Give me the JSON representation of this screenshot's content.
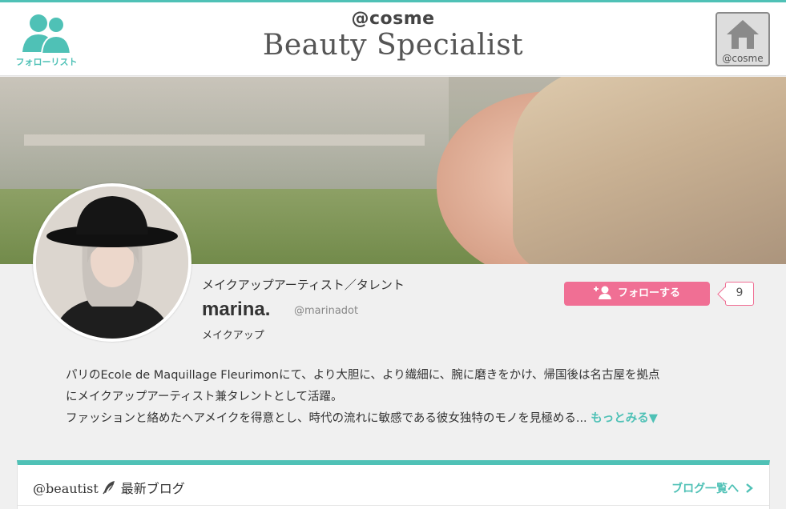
{
  "header": {
    "follow_list_label": "フォローリスト",
    "brand_top": "@cosme",
    "brand_main": "Beauty Specialist",
    "home_label": "@cosme"
  },
  "profile": {
    "role": "メイクアップアーティスト／タレント",
    "name": "marina.",
    "handle": "@marinadot",
    "genre": "メイクアップ",
    "follow_button": "フォローする",
    "follower_count": "9",
    "bio_lines": [
      "パリのEcole de Maquillage Fleurimonにて、より大胆に、より繊細に、腕に磨きをかけ、帰国後は名古屋を拠点",
      "にメイクアップアーティスト兼タレントとして活躍。",
      "ファッションと絡めたヘアメイクを得意とし、時代の流れに敏感である彼女独特のモノを見極める..."
    ],
    "more_label": "もっとみる▼"
  },
  "blog": {
    "brand": "@beautist",
    "title": "最新ブログ",
    "list_link": "ブログ一覧へ"
  },
  "colors": {
    "accent_teal": "#4fc1b6",
    "follow_pink": "#f06f94"
  },
  "icons": {
    "follow_list": "people-icon",
    "home": "house-icon",
    "follow": "add-person-icon",
    "blog": "quill-icon",
    "chevron": "chevron-right-icon"
  }
}
